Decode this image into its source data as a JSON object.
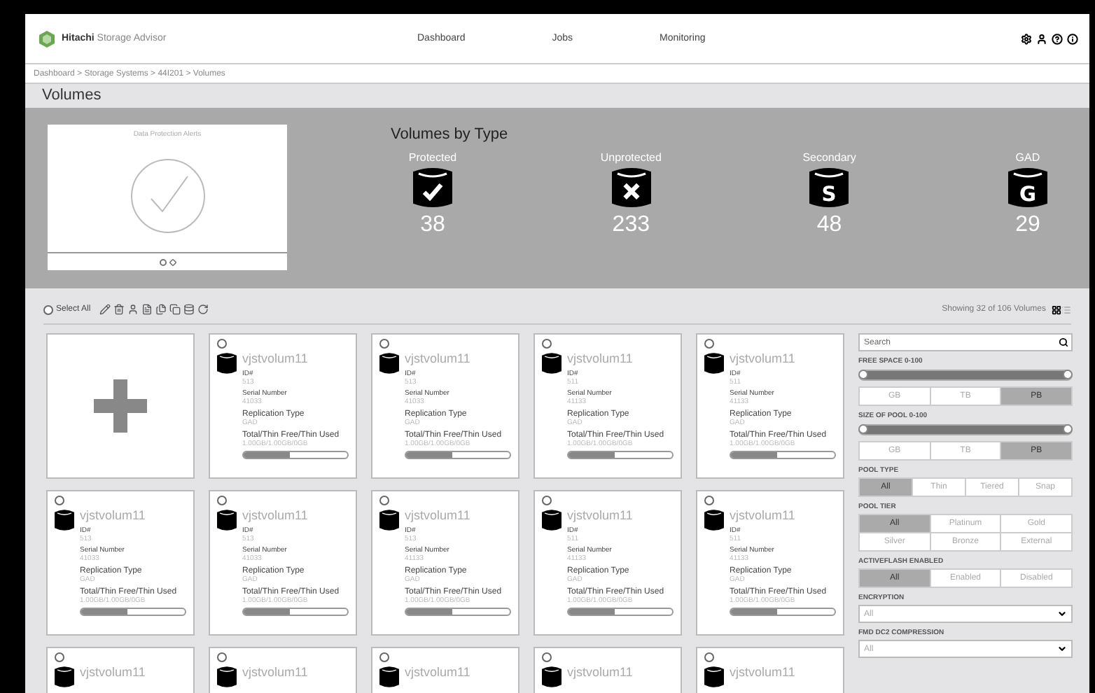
{
  "app": {
    "brand": "Hitachi",
    "product": "Storage Advisor"
  },
  "nav": [
    {
      "label": "Dashboard"
    },
    {
      "label": "Jobs"
    },
    {
      "label": "Monitoring"
    }
  ],
  "breadcrumb": "Dashboard > Storage Systems > 44I201 > Volumes",
  "page_title": "Volumes",
  "alerts": {
    "title": "Data Protection Alerts",
    "pager": [
      {
        "selected": true
      },
      {
        "selected": false
      }
    ]
  },
  "volumes_by_type": {
    "title": "Volumes by Type",
    "types": [
      {
        "label": "Protected",
        "kind": "check",
        "count": "38"
      },
      {
        "label": "Unprotected",
        "kind": "cross",
        "count": "233"
      },
      {
        "label": "Secondary",
        "kind": "letter",
        "glyph": "S",
        "count": "48"
      },
      {
        "label": "GAD",
        "kind": "letter",
        "glyph": "G",
        "count": "29"
      }
    ]
  },
  "toolbar": {
    "select_all": "Select All",
    "showing": "Showing 32 of 106 Volumes"
  },
  "volumes": [
    {
      "name": "vjstvolum11",
      "selected": false,
      "level": 0.45,
      "fields": [
        {
          "label": "ID#",
          "value": "513"
        },
        {
          "label": "Serial Number",
          "value": "41033"
        },
        {
          "label": "Replication Type",
          "value": "GAD"
        },
        {
          "label": "Total/Thin Free/Thin Used",
          "value": "1.00GB/1.00GB/0GB"
        }
      ]
    },
    {
      "name": "vjstvolum11",
      "selected": false,
      "level": 0.45,
      "fields": [
        {
          "label": "ID#",
          "value": "513"
        },
        {
          "label": "Serial Number",
          "value": "41033"
        },
        {
          "label": "Replication Type",
          "value": "GAD"
        },
        {
          "label": "Total/Thin Free/Thin Used",
          "value": "1.00GB/1.00GB/0GB"
        }
      ]
    },
    {
      "name": "vjstvolum11",
      "selected": false,
      "level": 0.45,
      "fields": [
        {
          "label": "ID#",
          "value": "511"
        },
        {
          "label": "Serial Number",
          "value": "41133"
        },
        {
          "label": "Replication Type",
          "value": "GAD"
        },
        {
          "label": "Total/Thin Free/Thin Used",
          "value": "1.00GB/1.00GB/0GB"
        }
      ]
    },
    {
      "name": "vjstvolum11",
      "selected": false,
      "level": 0.45,
      "fields": [
        {
          "label": "ID#",
          "value": "511"
        },
        {
          "label": "Serial Number",
          "value": "41133"
        },
        {
          "label": "Replication Type",
          "value": "GAD"
        },
        {
          "label": "Total/Thin Free/Thin Used",
          "value": "1.00GB/1.00GB/0GB"
        }
      ]
    },
    {
      "name": "vjstvolum11",
      "selected": false,
      "level": 0.45,
      "fields": [
        {
          "label": "ID#",
          "value": "513"
        },
        {
          "label": "Serial Number",
          "value": "41033"
        },
        {
          "label": "Replication Type",
          "value": "GAD"
        },
        {
          "label": "Total/Thin Free/Thin Used",
          "value": "1.00GB/1.00GB/0GB"
        }
      ]
    },
    {
      "name": "vjstvolum11",
      "selected": false,
      "level": 0.45,
      "fields": [
        {
          "label": "ID#",
          "value": "513"
        },
        {
          "label": "Serial Number",
          "value": "41033"
        },
        {
          "label": "Replication Type",
          "value": "GAD"
        },
        {
          "label": "Total/Thin Free/Thin Used",
          "value": "1.00GB/1.00GB/0GB"
        }
      ]
    },
    {
      "name": "vjstvolum11",
      "selected": false,
      "level": 0.45,
      "fields": [
        {
          "label": "ID#",
          "value": "513"
        },
        {
          "label": "Serial Number",
          "value": "41133"
        },
        {
          "label": "Replication Type",
          "value": "GAD"
        },
        {
          "label": "Total/Thin Free/Thin Used",
          "value": "1.00GB/1.00GB/0GB"
        }
      ]
    },
    {
      "name": "vjstvolum11",
      "selected": false,
      "level": 0.45,
      "fields": [
        {
          "label": "ID#",
          "value": "511"
        },
        {
          "label": "Serial Number",
          "value": "41133"
        },
        {
          "label": "Replication Type",
          "value": "GAD"
        },
        {
          "label": "Total/Thin Free/Thin Used",
          "value": "1.00GB/1.00GB/0GB"
        }
      ]
    },
    {
      "name": "vjstvolum11",
      "selected": false,
      "level": 0.45,
      "fields": [
        {
          "label": "ID#",
          "value": "511"
        },
        {
          "label": "Serial Number",
          "value": "41133"
        },
        {
          "label": "Replication Type",
          "value": "GAD"
        },
        {
          "label": "Total/Thin Free/Thin Used",
          "value": "1.00GB/1.00GB/0GB"
        }
      ]
    },
    {
      "name": "vjstvolum11",
      "selected": false
    },
    {
      "name": "vjstvolum11",
      "selected": false
    },
    {
      "name": "vjstvolum11",
      "selected": false
    },
    {
      "name": "vjstvolum11",
      "selected": false
    },
    {
      "name": "vjstvolum11",
      "selected": false
    }
  ],
  "filters": {
    "search_placeholder": "Search",
    "groups": [
      {
        "kind": "slider",
        "title": "FREE SPACE 0-100",
        "level": 1,
        "options": [
          {
            "label": "GB",
            "selected": false
          },
          {
            "label": "TB",
            "selected": false
          },
          {
            "label": "PB",
            "selected": true
          }
        ]
      },
      {
        "kind": "slider",
        "title": "SIZE OF POOL 0-100",
        "level": 1,
        "options": [
          {
            "label": "GB",
            "selected": false
          },
          {
            "label": "TB",
            "selected": false
          },
          {
            "label": "PB",
            "selected": true
          }
        ]
      },
      {
        "kind": "segments",
        "title": "POOL TYPE",
        "options": [
          {
            "label": "All",
            "selected": true
          },
          {
            "label": "Thin",
            "selected": false
          },
          {
            "label": "Tiered",
            "selected": false
          },
          {
            "label": "Snap",
            "selected": false
          }
        ]
      },
      {
        "kind": "segments",
        "title": "POOL TIER",
        "options": [
          {
            "label": "All",
            "selected": true
          },
          {
            "label": "Platinum",
            "selected": false
          },
          {
            "label": "Gold",
            "selected": false
          },
          {
            "label": "Silver",
            "selected": false
          },
          {
            "label": "Bronze",
            "selected": false
          },
          {
            "label": "External",
            "selected": false
          }
        ]
      },
      {
        "kind": "segments",
        "title": "ACTIVEFLASH ENABLED",
        "options": [
          {
            "label": "All",
            "selected": true
          },
          {
            "label": "Enabled",
            "selected": false
          },
          {
            "label": "Disabled",
            "selected": false
          }
        ]
      },
      {
        "kind": "select",
        "title": "ENCRYPTION",
        "value": "All"
      },
      {
        "kind": "select",
        "title": "FMD DC2 COMPRESSION",
        "value": "All"
      }
    ]
  }
}
